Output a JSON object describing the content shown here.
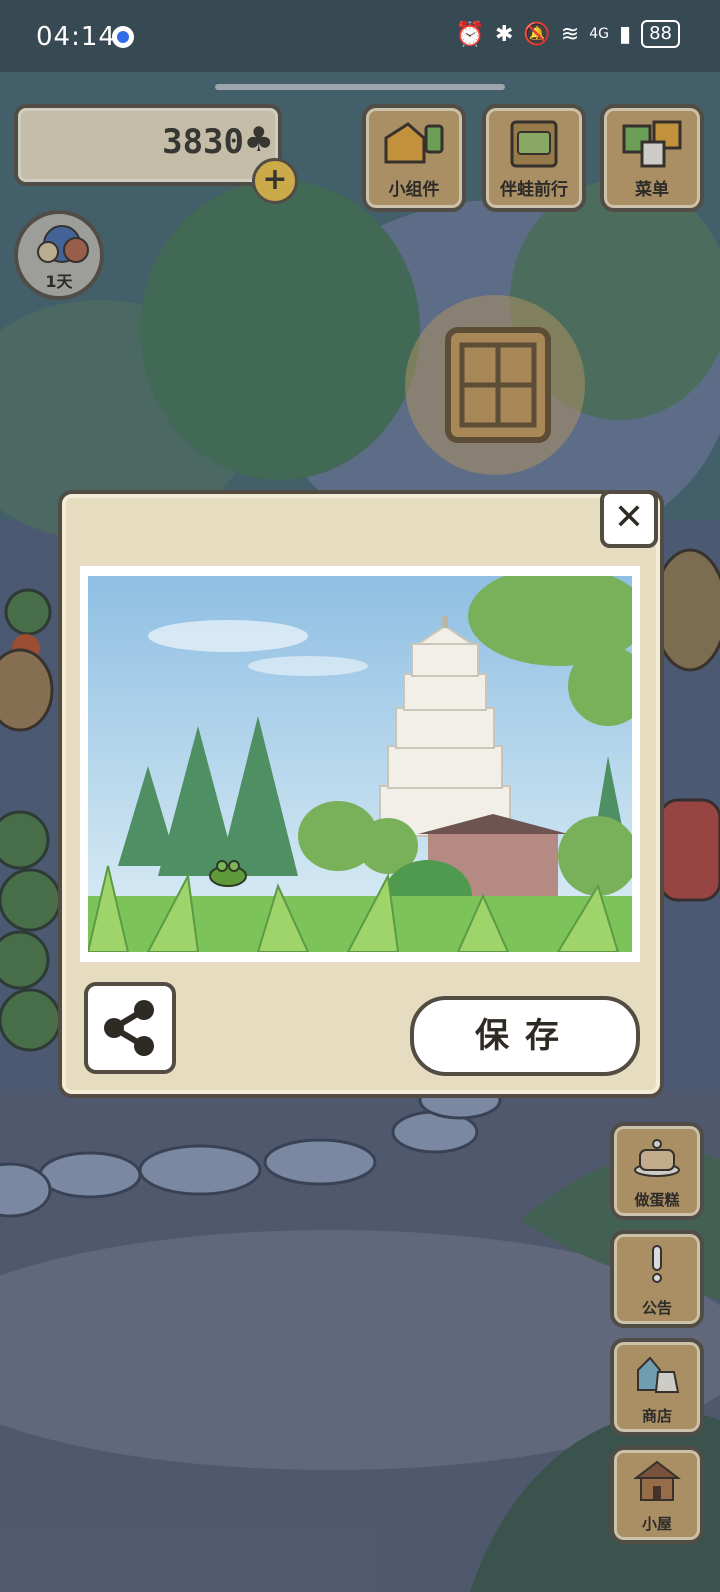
{
  "status_bar": {
    "time": "04:14",
    "battery": "88",
    "network": "4G"
  },
  "currency": {
    "amount": "3830",
    "symbol": "♣"
  },
  "top_buttons": [
    {
      "label": "小组件",
      "icon": "widget-icon"
    },
    {
      "label": "伴蛙前行",
      "icon": "journal-icon"
    },
    {
      "label": "菜单",
      "icon": "menu-icon"
    }
  ],
  "pet": {
    "days": "1天"
  },
  "side_buttons": [
    {
      "label": "做蛋糕",
      "icon": "cake-icon"
    },
    {
      "label": "公告",
      "icon": "exclamation-icon"
    },
    {
      "label": "商店",
      "icon": "shop-bags-icon"
    },
    {
      "label": "小屋",
      "icon": "house-icon"
    }
  ],
  "dialog": {
    "save_label": "保存"
  },
  "colors": {
    "panel": "#e6dcc0",
    "border": "#524c42",
    "wood": "#c9a46b",
    "coin_button": "#f0c64a"
  }
}
